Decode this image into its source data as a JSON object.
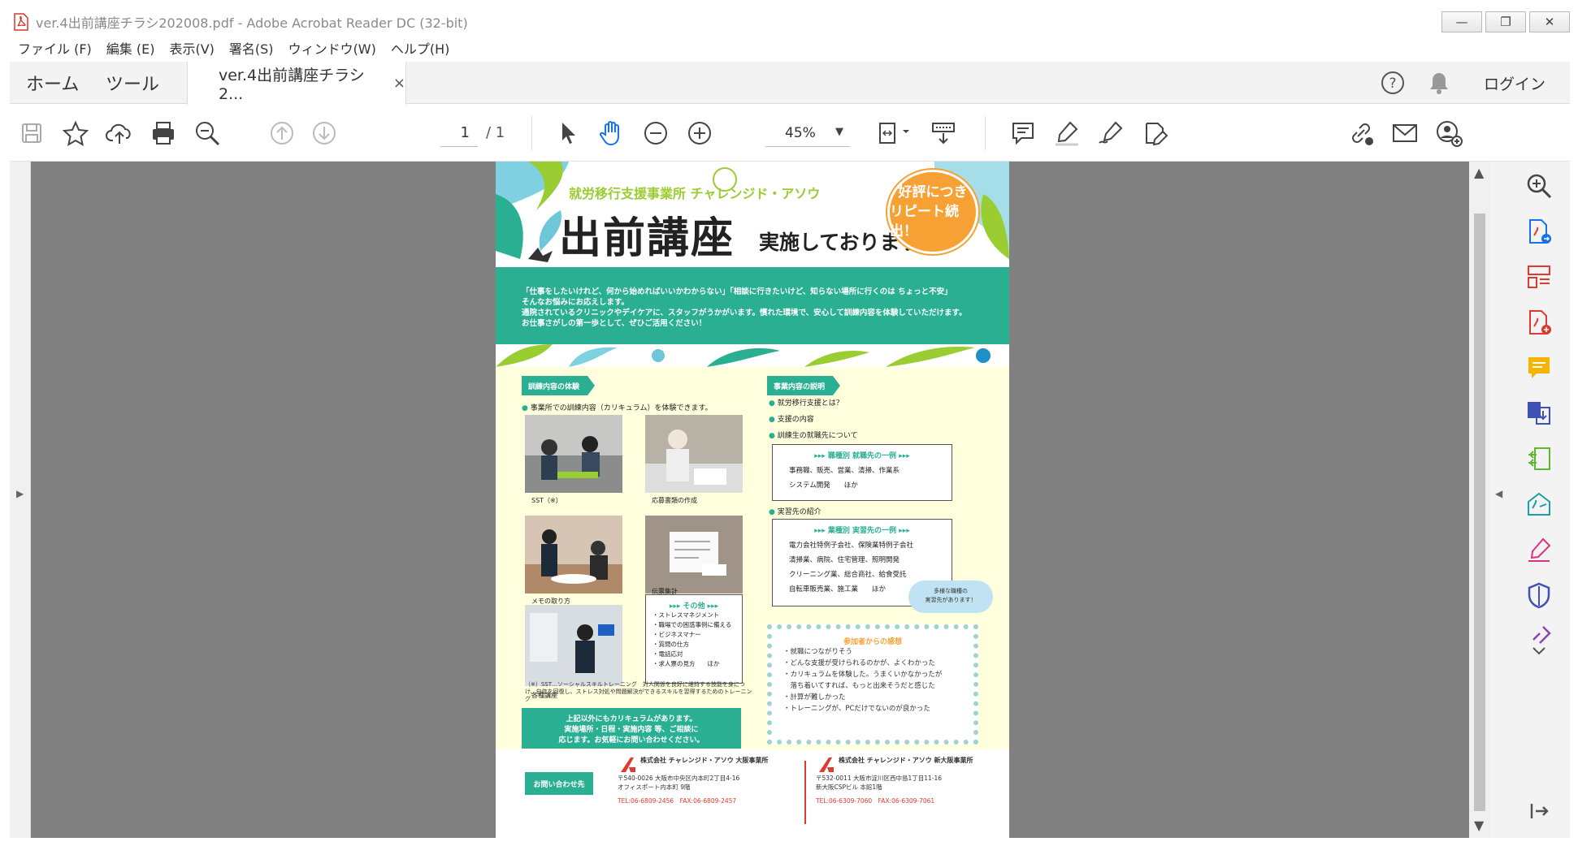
{
  "window": {
    "title": "ver.4出前講座チラシ202008.pdf - Adobe Acrobat Reader DC (32-bit)",
    "controls": {
      "minimize": "—",
      "restore": "❐",
      "close": "✕"
    }
  },
  "menu": [
    "ファイル (F)",
    "編集 (E)",
    "表示(V)",
    "署名(S)",
    "ウィンドウ(W)",
    "ヘルプ(H)"
  ],
  "tabs": {
    "home": "ホーム",
    "tools": "ツール",
    "document": "ver.4出前講座チラシ2...",
    "close": "×",
    "login": "ログイン"
  },
  "toolbar": {
    "page_current": "1",
    "page_total": "/ 1",
    "zoom": "45%"
  },
  "flyer": {
    "brand": "就労移行支援事業所 チャレンジド・アソウ",
    "main_title": "出前講座",
    "subtitle": "実施しております。",
    "badge_line1": "好評につき",
    "badge_line2": "リピート続出！",
    "intro": [
      "「仕事をしたいけれど、何から始めればいいかわからない」「相談に行きたいけど、知らない場所に行くのは ちょっと不安」",
      "そんなお悩みにお応えします。",
      "通院されているクリニックやデイケアに、スタッフがうかがいます。慣れた環境で、安心して訓練内容を体験していただけます。",
      "お仕事さがしの第一歩として、ぜひご活用ください！"
    ],
    "section_left": "訓練内容の体験",
    "section_left_text": "事業所での訓練内容（カリキュラム）を体験できます。",
    "photo_captions": [
      "SST（※）",
      "応募書類の作成",
      "メモの取り方",
      "伝票集計",
      "各種講座"
    ],
    "other_box": {
      "title": "▸▸▸ その他 ▸▸▸",
      "items": [
        "・ストレスマネジメント",
        "・職場での困惑事例に備える",
        "・ビジネスマナー",
        "・質問の仕方",
        "・電話応対",
        "・求人票の見方　　ほか"
      ]
    },
    "sst_note": "（※）SST…ソーシャルスキルトレーニング　対人関係を良好に維持する技能を身につけ、自信を回復し、ストレス対処や問題解決ができるスキルを習得するためのトレーニング",
    "green_box": [
      "上記以外にもカリキュラムがあります。",
      "実施場所・日程・実施内容 等、ご相談に",
      "応じます。お気軽にお問い合わせください。"
    ],
    "section_right": "事業内容の説明",
    "right_items": [
      "就労移行支援とは？",
      "支援の内容",
      "訓練生の就職先について"
    ],
    "job_box": {
      "title": "▸▸▸ 職種別 就職先の一例 ▸▸▸",
      "lines": [
        "事務職、販売、営業、清掃、作業系",
        "システム開発　　ほか"
      ]
    },
    "intern_label": "実習先の紹介",
    "intern_box": {
      "title": "▸▸▸ 業種別 実習先の一例 ▸▸▸",
      "lines": [
        "電力会社特例子会社、保険業特例子会社",
        "清掃業、病院、住宅管理、照明開発",
        "クリーニング業、総合商社、給食受託",
        "自転車販売業、施工業　　ほか"
      ]
    },
    "cloud": [
      "多様な職種の",
      "実習先があります！"
    ],
    "impressions": {
      "title": "参加者からの感想",
      "items": [
        "・就職につながりそう",
        "・どんな支援が受けられるのかが、よくわかった",
        "・カリキュラムを体験した。うまくいかなかったが",
        "　落ち着いてすれば、もっと出来そうだと感じた",
        "・計算が難しかった",
        "・トレーニングが、PCだけでないのが良かった"
      ]
    },
    "contact_label": "お問い合わせ先",
    "office1": {
      "name": "株式会社 チャレンジド・アソウ 大阪事業所",
      "addr1": "〒540-0026 大阪市中央区内本町2丁目4-16",
      "addr2": "オフィスポート内本町 9階",
      "tel": "TEL:06-6809-2456　FAX:06-6809-2457"
    },
    "office2": {
      "name": "株式会社 チャレンジド・アソウ 新大阪事業所",
      "addr1": "〒532-0011 大阪市淀川区西中島1丁目11-16",
      "addr2": "新大阪CSPビル 本館1階",
      "tel": "TEL:06-6309-7060　FAX:06-6309-7061"
    }
  },
  "colors": {
    "teal": "#2aaf92",
    "orange": "#f7a135",
    "canvas": "#808080",
    "accent_blue": "#1473e6",
    "acrobat_red": "#e03a2e"
  }
}
